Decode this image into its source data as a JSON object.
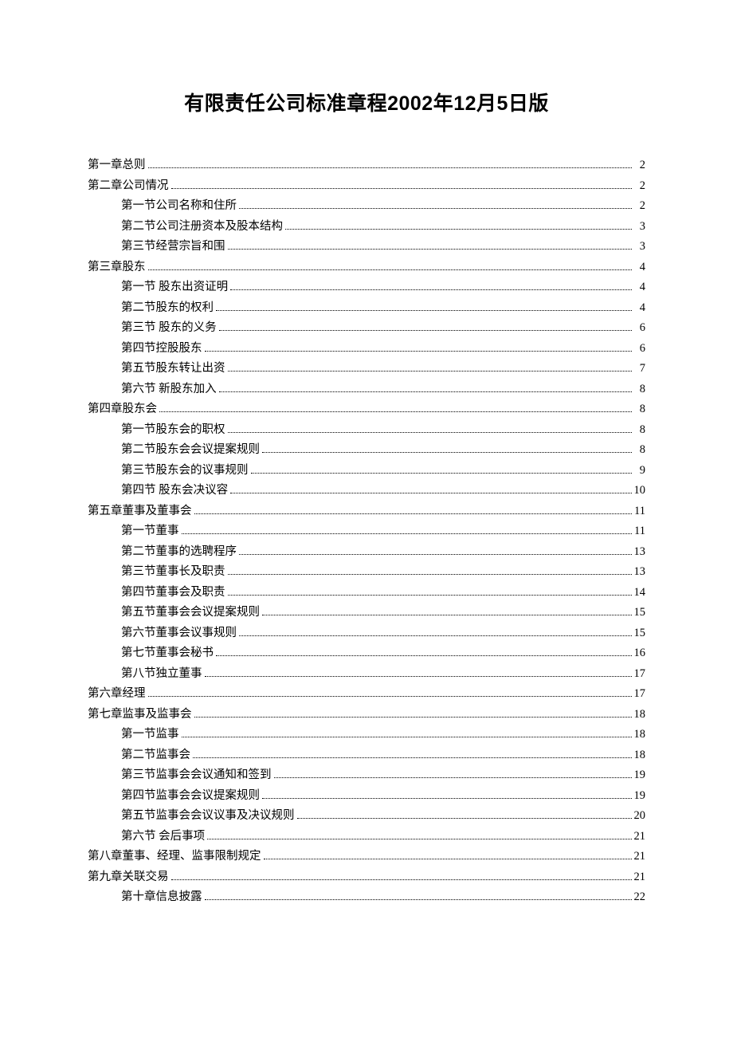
{
  "title": "有限责任公司标准章程2002年12月5日版",
  "toc": [
    {
      "level": 1,
      "label": "第一章总则",
      "page": "2"
    },
    {
      "level": 1,
      "label": "第二章公司情况",
      "page": "2"
    },
    {
      "level": 2,
      "label": "第一节公司名称和住所",
      "page": "2"
    },
    {
      "level": 2,
      "label": "第二节公司注册资本及股本结构",
      "page": "3"
    },
    {
      "level": 2,
      "label": "第三节经营宗旨和围",
      "page": "3"
    },
    {
      "level": 1,
      "label": "第三章股东",
      "page": "4"
    },
    {
      "level": 2,
      "label": "第一节  股东出资证明",
      "page": "4"
    },
    {
      "level": 2,
      "label": "第二节股东的权利",
      "page": "4"
    },
    {
      "level": 2,
      "label": "第三节  股东的义务",
      "page": "6"
    },
    {
      "level": 2,
      "label": "第四节控股股东",
      "page": "6"
    },
    {
      "level": 2,
      "label": "第五节股东转让出资",
      "page": "7"
    },
    {
      "level": 2,
      "label": "第六节  新股东加入",
      "page": "8"
    },
    {
      "level": 1,
      "label": "第四章股东会",
      "page": "8"
    },
    {
      "level": 2,
      "label": "第一节股东会的职权",
      "page": "8"
    },
    {
      "level": 2,
      "label": "第二节股东会会议提案规则",
      "page": "8"
    },
    {
      "level": 2,
      "label": "第三节股东会的议事规则",
      "page": "9"
    },
    {
      "level": 2,
      "label": "第四节  股东会决议容",
      "page": "10"
    },
    {
      "level": 1,
      "label": "第五章董事及董事会",
      "page": "11"
    },
    {
      "level": 2,
      "label": "第一节董事",
      "page": "11"
    },
    {
      "level": 2,
      "label": "第二节董事的选聘程序",
      "page": "13"
    },
    {
      "level": 2,
      "label": "第三节董事长及职责",
      "page": "13"
    },
    {
      "level": 2,
      "label": "第四节董事会及职责",
      "page": "14"
    },
    {
      "level": 2,
      "label": "第五节董事会会议提案规则",
      "page": "15"
    },
    {
      "level": 2,
      "label": "第六节董事会议事规则",
      "page": "15"
    },
    {
      "level": 2,
      "label": "第七节董事会秘书",
      "page": "16"
    },
    {
      "level": 2,
      "label": "第八节独立董事",
      "page": "17"
    },
    {
      "level": 1,
      "label": "第六章经理",
      "page": "17"
    },
    {
      "level": 1,
      "label": "第七章监事及监事会",
      "page": "18"
    },
    {
      "level": 2,
      "label": "第一节监事",
      "page": "18"
    },
    {
      "level": 2,
      "label": "第二节监事会",
      "page": "18"
    },
    {
      "level": 2,
      "label": "第三节监事会会议通知和签到",
      "page": "19"
    },
    {
      "level": 2,
      "label": "第四节监事会会议提案规则",
      "page": "19"
    },
    {
      "level": 2,
      "label": "第五节监事会会议议事及决议规则",
      "page": "20"
    },
    {
      "level": 2,
      "label": "第六节  会后事项",
      "page": "21"
    },
    {
      "level": 1,
      "label": "第八章董事、经理、监事限制规定",
      "page": "21"
    },
    {
      "level": 1,
      "label": "第九章关联交易",
      "page": "21"
    },
    {
      "level": 2,
      "label": "第十章信息披露",
      "page": "22"
    }
  ]
}
